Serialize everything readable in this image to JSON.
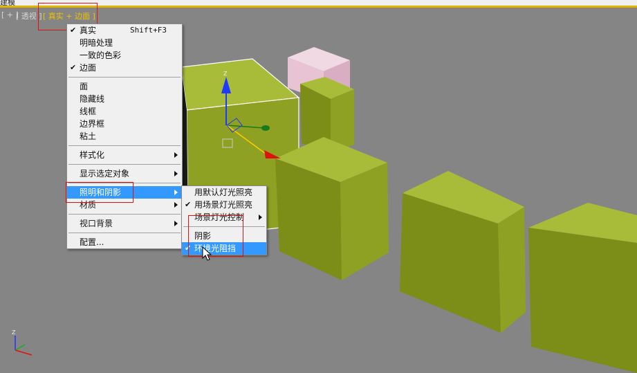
{
  "window": {
    "title_fragment": "建模"
  },
  "viewport": {
    "labels": [
      "[ + ]",
      "[ 透视 ]",
      "[ 真实 + 边面 ]"
    ]
  },
  "menu": {
    "items": [
      {
        "label": "真实",
        "checked": true,
        "shortcut": "Shift+F3"
      },
      {
        "label": "明暗处理"
      },
      {
        "label": "一致的色彩"
      },
      {
        "label": "边面",
        "checked": true
      },
      {
        "label": "面"
      },
      {
        "label": "隐藏线"
      },
      {
        "label": "线框"
      },
      {
        "label": "边界框"
      },
      {
        "label": "粘土"
      },
      {
        "label": "样式化",
        "submenu": true
      },
      {
        "label": "显示选定对象",
        "submenu": true
      },
      {
        "label": "照明和阴影",
        "submenu": true,
        "highlighted": true
      },
      {
        "label": "材质",
        "submenu": true
      },
      {
        "label": "视口背景",
        "submenu": true
      },
      {
        "label": "配置..."
      }
    ],
    "check_mark": "✔"
  },
  "submenu": {
    "items": [
      {
        "label": "用默认灯光照亮"
      },
      {
        "label": "用场景灯光照亮",
        "checked": true
      },
      {
        "label": "场景灯光控制",
        "submenu": true
      },
      {
        "label": "阴影"
      },
      {
        "label": "环境光阻挡",
        "checked": true,
        "highlighted": true
      }
    ]
  },
  "gizmo": {
    "z_label": "Z"
  },
  "axis_tripod": {
    "z_label": "Z"
  },
  "colors": {
    "box_front": "#8ea123",
    "box_top": "#a9bc3a",
    "box_side": "#6f7f14",
    "pink_box": "#e7c3d4",
    "highlight": "#3399ff",
    "annotation_red": "#e01010"
  }
}
